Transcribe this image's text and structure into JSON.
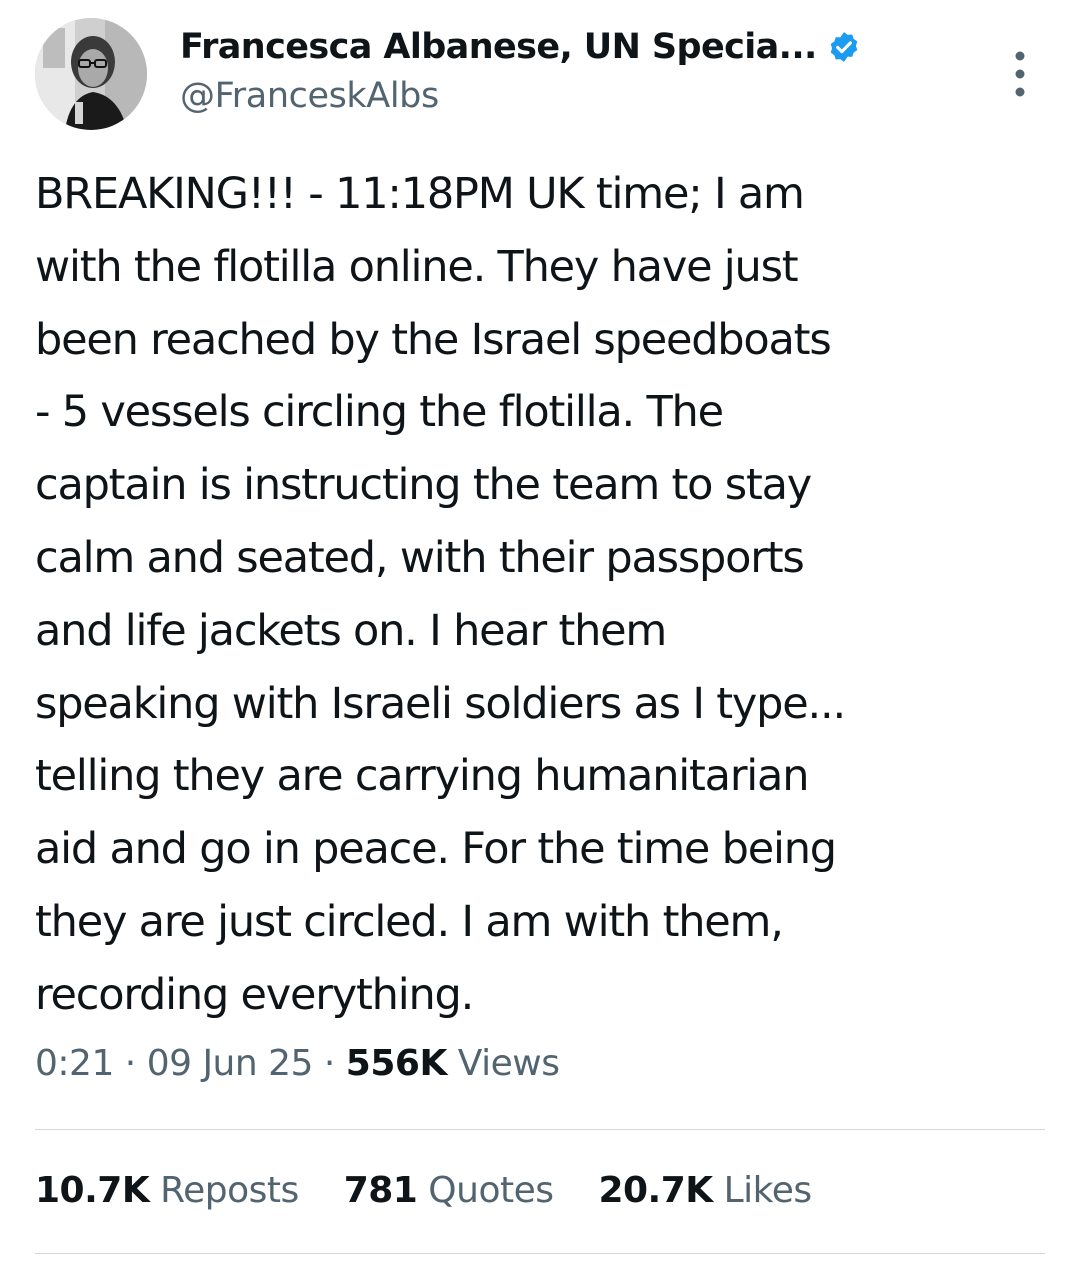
{
  "author": {
    "display_name": "Francesca Albanese, UN Specia...",
    "handle": "@FranceskAlbs",
    "verified_icon": "verified-badge-icon",
    "avatar_icon": "avatar-photo"
  },
  "tweet": {
    "lines": [
      "BREAKING!!! - 11:18PM UK time; I am",
      "with the flotilla online. They have just",
      "been reached by the Israel speedboats",
      "- 5 vessels circling the flotilla. The",
      "captain is instructing the team to stay",
      "calm and seated, with their passports",
      "and life jackets on. I hear them",
      "speaking with Israeli soldiers as I type...",
      "telling they are carrying humanitarian",
      "aid and go in peace. For the time being",
      "they are just circled. I am with them,",
      "recording everything."
    ]
  },
  "meta": {
    "time": "0:21",
    "sep1": " · ",
    "date": "09 Jun 25",
    "sep2": " · ",
    "views_count": "556K",
    "views_label": "Views"
  },
  "stats": {
    "reposts_count": "10.7K",
    "reposts_label": "Reposts",
    "quotes_count": "781",
    "quotes_label": "Quotes",
    "likes_count": "20.7K",
    "likes_label": "Likes"
  },
  "colors": {
    "text_primary": "#0f1419",
    "text_secondary": "#536471",
    "verified_blue": "#1d9bf0",
    "divider": "#cfd9de"
  }
}
